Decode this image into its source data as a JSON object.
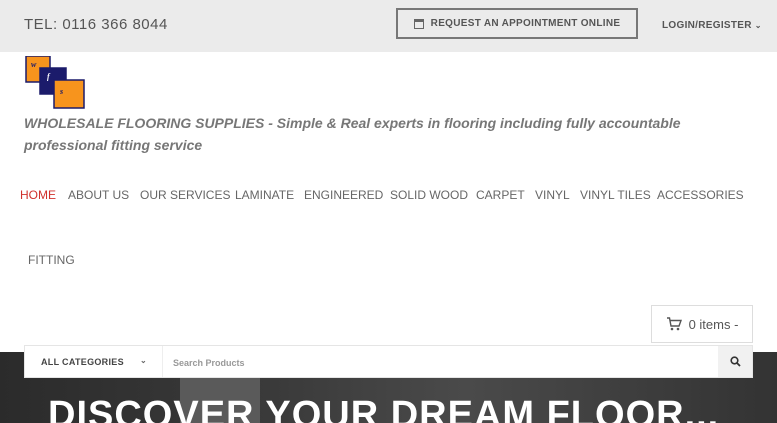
{
  "topbar": {
    "phone": "TEL: 0116 366 8044",
    "appointment_label": "REQUEST AN APPOINTMENT ONLINE",
    "appointment_icon": "calendar-icon",
    "login_label": "LOGIN/REGISTER"
  },
  "logo": {
    "letters": [
      "w",
      "f",
      "s"
    ],
    "colors": {
      "orange": "#f7941d",
      "navy": "#1b1b6b"
    }
  },
  "tagline": "WHOLESALE FLOORING SUPPLIES - Simple & Real experts in flooring including fully accountable professional fitting service",
  "nav": {
    "items": [
      "HOME",
      "ABOUT US",
      "OUR SERVICES",
      "LAMINATE",
      "ENGINEERED",
      "SOLID WOOD",
      "CARPET",
      "VINYL",
      "VINYL TILES",
      "ACCESSORIES",
      "FITTING"
    ],
    "active": "HOME",
    "active_color": "#d0312d"
  },
  "cart": {
    "label": "0 items -",
    "icon": "cart-icon"
  },
  "search": {
    "category": "ALL CATEGORIES",
    "placeholder": "Search Products",
    "icon": "search-icon"
  },
  "hero": {
    "title": "DISCOVER YOUR DREAM FLOOR..."
  }
}
